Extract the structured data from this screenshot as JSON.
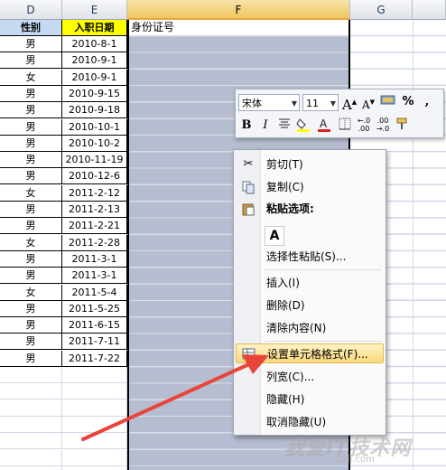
{
  "columns": {
    "d": "D",
    "e": "E",
    "f": "F",
    "g": "G"
  },
  "headers": {
    "gender": "性别",
    "hire_date": "入职日期",
    "id_number": "身份证号"
  },
  "rows": [
    {
      "gender": "男",
      "date": "2010-8-1"
    },
    {
      "gender": "男",
      "date": "2010-9-1"
    },
    {
      "gender": "女",
      "date": "2010-9-1"
    },
    {
      "gender": "男",
      "date": "2010-9-15"
    },
    {
      "gender": "男",
      "date": "2010-9-18"
    },
    {
      "gender": "男",
      "date": "2010-10-1"
    },
    {
      "gender": "男",
      "date": "2010-10-2"
    },
    {
      "gender": "男",
      "date": "2010-11-19"
    },
    {
      "gender": "男",
      "date": "2010-12-6"
    },
    {
      "gender": "女",
      "date": "2011-2-12"
    },
    {
      "gender": "男",
      "date": "2011-2-13"
    },
    {
      "gender": "男",
      "date": "2011-2-21"
    },
    {
      "gender": "女",
      "date": "2011-2-28"
    },
    {
      "gender": "男",
      "date": "2011-3-1"
    },
    {
      "gender": "男",
      "date": "2011-3-1"
    },
    {
      "gender": "女",
      "date": "2011-5-4"
    },
    {
      "gender": "男",
      "date": "2011-5-25"
    },
    {
      "gender": "男",
      "date": "2011-6-15"
    },
    {
      "gender": "男",
      "date": "2011-7-11"
    },
    {
      "gender": "男",
      "date": "2011-7-22"
    }
  ],
  "mini_toolbar": {
    "font": "宋体",
    "size": "11",
    "grow": "A",
    "shrink": "A",
    "percent": "%",
    "comma": ",",
    "bold": "B",
    "italic": "I"
  },
  "context_menu": {
    "cut": "剪切(T)",
    "copy": "复制(C)",
    "paste_options": "粘贴选项:",
    "paste_icon": "A",
    "paste_special": "选择性粘贴(S)...",
    "insert": "插入(I)",
    "delete": "删除(D)",
    "clear": "清除内容(N)",
    "format_cells": "设置单元格格式(F)...",
    "column_width": "列宽(C)...",
    "hide": "隐藏(H)",
    "unhide": "取消隐藏(U)"
  },
  "watermark": {
    "text": "我爱IT技术网",
    "url": "52ij.com"
  },
  "colors": {
    "header_yellow": "#ffff00",
    "selection": "#b7bdd0",
    "arrow": "#e8443a",
    "highlight": "#fbd77c"
  }
}
